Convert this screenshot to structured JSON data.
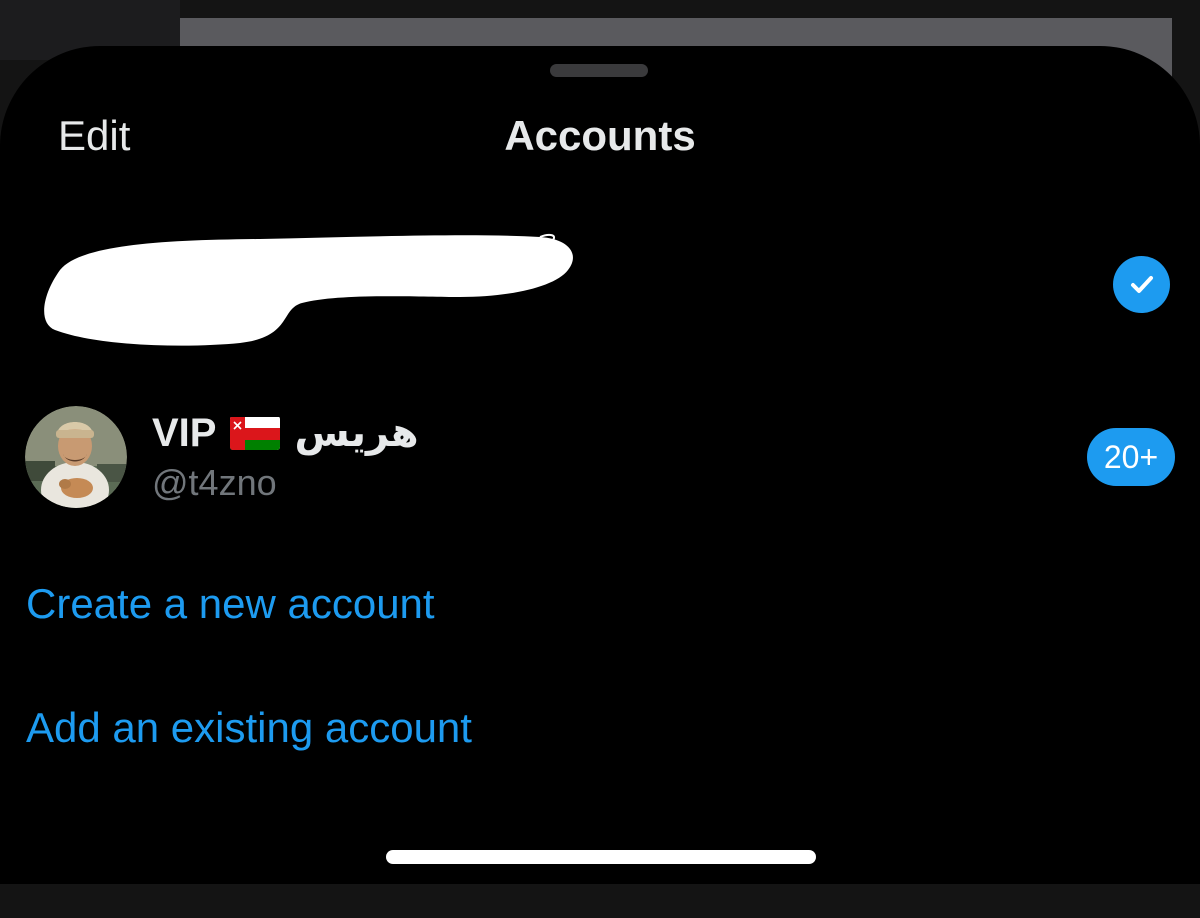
{
  "header": {
    "edit_label": "Edit",
    "title": "Accounts"
  },
  "current_account": {
    "redacted": true,
    "selected_icon": "checkmark-icon"
  },
  "accounts": [
    {
      "display_name_latin": "VIP",
      "flag": "oman-flag",
      "display_name_arabic": "هريس",
      "handle": "@t4zno",
      "notification_count": "20+"
    }
  ],
  "actions": {
    "create_label": "Create a new account",
    "add_label": "Add an existing account"
  },
  "colors": {
    "accent": "#1d9bf0",
    "background": "#000000",
    "text_primary": "#e7e9ea",
    "text_secondary": "#71767b"
  }
}
